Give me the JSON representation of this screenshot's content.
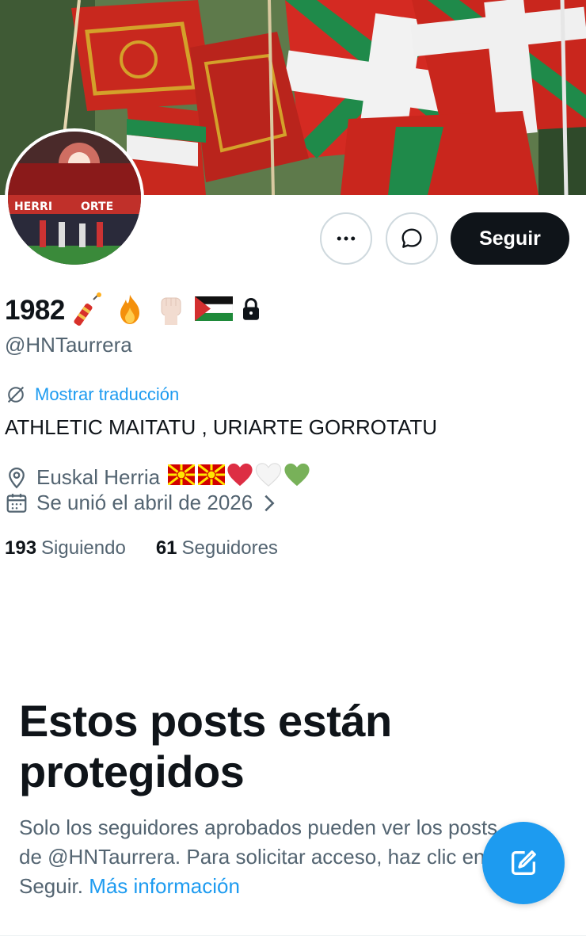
{
  "profile": {
    "display_name": "1982",
    "name_emojis": [
      "firecracker-emoji",
      "fire-emoji",
      "raised-fist-emoji",
      "palestine-flag-emoji"
    ],
    "locked": true,
    "handle": "@HNTaurrera",
    "translate_label": "Mostrar traducción",
    "bio": "ATHLETIC MAITATU , URIARTE GORROTATU",
    "location": "Euskal Herria",
    "location_emojis": [
      "north-macedonia-flag-emoji",
      "north-macedonia-flag-emoji",
      "red-heart-emoji",
      "white-heart-emoji",
      "green-heart-emoji"
    ],
    "joined": "Se unió el abril de 2026",
    "following_count": "193",
    "following_label": "Siguiendo",
    "followers_count": "61",
    "followers_label": "Seguidores"
  },
  "actions": {
    "more_icon": "more-horizontal-icon",
    "message_icon": "message-bubble-icon",
    "follow_label": "Seguir",
    "compose_icon": "compose-icon"
  },
  "protected": {
    "title": "Estos posts están protegidos",
    "text_line1": "Solo los seguidores aprobados pueden ver los posts",
    "text_line2": "de @HNTaurrera. Para solicitar acceso, haz clic en",
    "text_line3": "Seguir.",
    "link": "Más información"
  },
  "colors": {
    "accent": "#1d9bf0",
    "text_primary": "#0f1419",
    "text_secondary": "#536471",
    "follow_button": "#0f1419"
  }
}
